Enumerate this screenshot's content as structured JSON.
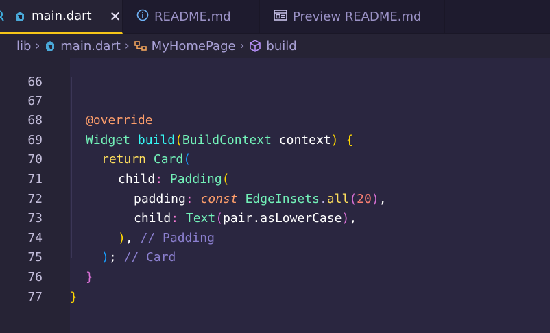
{
  "tabs": [
    {
      "label": "main.dart",
      "icon": "dart-icon",
      "active": true,
      "close": "✕"
    },
    {
      "label": "README.md",
      "icon": "info-icon",
      "active": false
    },
    {
      "label": "Preview README.md",
      "icon": "preview-icon",
      "active": false
    }
  ],
  "breadcrumb": {
    "items": [
      "lib",
      "main.dart",
      "MyHomePage",
      "build"
    ]
  },
  "editor": {
    "lines": [
      {
        "n": "66"
      },
      {
        "n": "67"
      },
      {
        "n": "68"
      },
      {
        "n": "69"
      },
      {
        "n": "70"
      },
      {
        "n": "71"
      },
      {
        "n": "72"
      },
      {
        "n": "73"
      },
      {
        "n": "74"
      },
      {
        "n": "75"
      },
      {
        "n": "76"
      },
      {
        "n": "77"
      }
    ],
    "tokens": {
      "override": "@override",
      "widget": "Widget",
      "build": "build",
      "ctx_type": "BuildContext",
      "ctx_var": "context",
      "ret": "return",
      "card": "Card",
      "child": "child",
      "padding_w": "Padding",
      "padding_p": "padding",
      "const_kw": "const",
      "edge": "EdgeInsets",
      "all": "all",
      "num20": "20",
      "text_w": "Text",
      "pair": "pair",
      "lower": "asLowerCase",
      "cmt_padding": "// Padding",
      "cmt_card": "// Card"
    }
  },
  "colors": {
    "background": "#262335",
    "tabbar": "#1e1b2e",
    "active_tab_accent": "#f5c518"
  }
}
